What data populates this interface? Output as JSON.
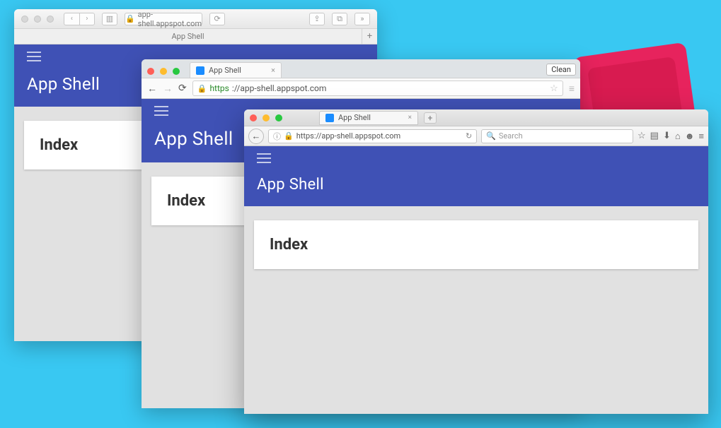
{
  "safari": {
    "url_display": "app-shell.appspot.com",
    "tab_title": "App Shell"
  },
  "chrome": {
    "tab_title": "App Shell",
    "clean_button": "Clean",
    "url_scheme": "https",
    "url_rest": "://app-shell.appspot.com"
  },
  "firefox": {
    "tab_title": "App Shell",
    "url": "https://app-shell.appspot.com",
    "search_placeholder": "Search"
  },
  "app": {
    "title": "App Shell",
    "card_heading": "Index"
  }
}
